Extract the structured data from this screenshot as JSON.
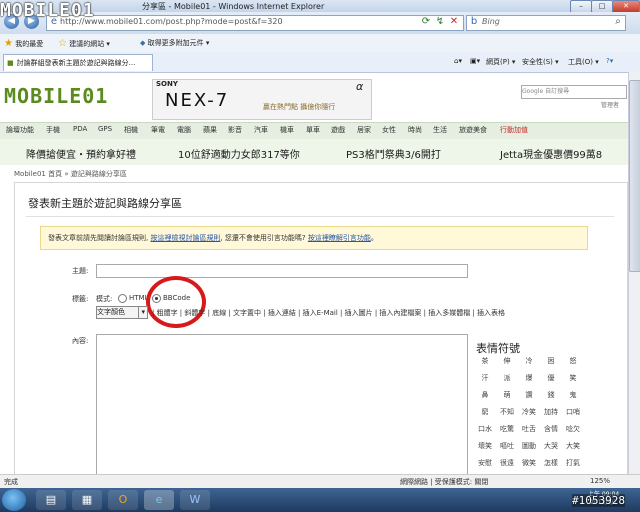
{
  "window": {
    "title": "分享區 - Mobile01 - Windows Internet Explorer",
    "controls": [
      "–",
      "□",
      "✕"
    ]
  },
  "address_bar": {
    "url": "http://www.mobile01.com/post.php?mode=post&f=320",
    "search_placeholder": "Bing"
  },
  "favorites": {
    "items": [
      "我的最愛",
      "建議的網站 ▾",
      "取得更多附加元件 ▾"
    ]
  },
  "tab": {
    "label": "討論群組發表新主題於遊記與路線分..."
  },
  "command_bar": {
    "items": [
      "網頁(P) ▾",
      "安全性(S) ▾",
      "工具(O) ▾"
    ]
  },
  "site": {
    "logo": "MOBILE01",
    "ad": {
      "brand": "SONY",
      "model": "NEX-7",
      "tagline": "贏在熱門點 攝億你隨行",
      "mark": "α"
    },
    "google_label": "Google 自訂搜尋",
    "admin_link": "管理者"
  },
  "menu": [
    "論壇功能",
    "手機",
    "PDA",
    "GPS",
    "相機",
    "筆電",
    "電腦",
    "蘋果",
    "影音",
    "汽車",
    "機車",
    "單車",
    "遊戲",
    "居家",
    "女性",
    "時尚",
    "生活",
    "旅遊美食",
    "行動加值"
  ],
  "promos": [
    "降價搶便宜・預約拿好禮",
    "10位舒適動力女郎317等你",
    "PS3格鬥祭典3/6開打",
    "Jetta現金優惠價99萬8"
  ],
  "breadcrumb": "Mobile01 首頁 » 遊記與路線分享區",
  "form": {
    "title": "發表新主題於遊記與路線分享區",
    "notice_prefix": "發表文章前請先閱讀討論區規則,",
    "notice_link1": "按這裡檢視討論區規則",
    "notice_middle": ", 您還不會使用引言功能嗎?",
    "notice_link2": "按這裡瞭解引言功能",
    "notice_suffix": "。",
    "subject_label": "主題:",
    "mark_label": "標籤:",
    "mode_label": "模式:",
    "mode_html": "HTML",
    "mode_bbcode": "BBCode",
    "color_select": "文字顏色",
    "toolbar": "| 粗體字 | 斜體字 | 底線 | 文字置中 | 插入連結 | 插入E-Mail | 插入圖片 | 插入內建檔案 | 插入多媒體檔 | 插入表格",
    "content_label": "內容:"
  },
  "emoticons": {
    "title": "表情符號",
    "items": [
      "茶",
      "伸",
      "冷",
      "困",
      "怒",
      "汗",
      "派",
      "爆",
      "優",
      "笑",
      "鼻",
      "萌",
      "讚",
      "錢",
      "鬼",
      "窮",
      "不知",
      "冷笑",
      "加持",
      "口哨",
      "口水",
      "吃驚",
      "吐舌",
      "含情",
      "唸欠",
      "壞笑",
      "嘔吐",
      "圖動",
      "大哭",
      "大笑",
      "安慰",
      "很遠",
      "微笑",
      "怎樣",
      "打氣"
    ]
  },
  "status_bar": {
    "left": "完成",
    "zone": "網際網路 | 受保護模式: 關閉",
    "zoom": "125%"
  },
  "taskbar": {
    "time": "上午 09:04",
    "date": "2012/3/1"
  },
  "watermark": {
    "logo": "MOBILE01",
    "id": "#1053928"
  }
}
